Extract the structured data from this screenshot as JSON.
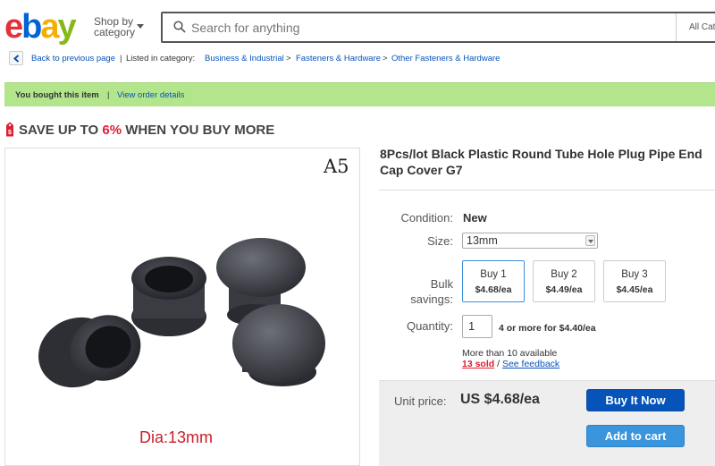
{
  "header": {
    "logo": {
      "e": "e",
      "b": "b",
      "a": "a",
      "y": "y"
    },
    "shop_by_line1": "Shop by",
    "shop_by_line2": "category",
    "search_placeholder": "Search for anything",
    "search_category": "All Cate"
  },
  "breadcrumb": {
    "back_label": "Back to previous page",
    "sep": "|",
    "listed_label": "Listed in category:",
    "items": [
      "Business & Industrial",
      "Fasteners & Hardware",
      "Other Fasteners & Hardware"
    ],
    "arrow": ">"
  },
  "bought_bar": {
    "text": "You bought this item",
    "sep": "|",
    "link": "View order details"
  },
  "save_banner": {
    "prefix": "SAVE UP TO ",
    "percent": "6%",
    "suffix": " WHEN YOU BUY MORE"
  },
  "image": {
    "corner_label": "A5",
    "caption": "Dia:13mm"
  },
  "item": {
    "title": "8Pcs/lot Black Plastic Round Tube Hole Plug Pipe End Cap Cover G7",
    "condition_label": "Condition:",
    "condition_value": "New",
    "size_label": "Size:",
    "size_value": "13mm",
    "bulk_label_1": "Bulk",
    "bulk_label_2": "savings:",
    "bulk_options": [
      {
        "qty": "Buy 1",
        "price": "$4.68/ea"
      },
      {
        "qty": "Buy 2",
        "price": "$4.49/ea"
      },
      {
        "qty": "Buy 3",
        "price": "$4.45/ea"
      }
    ],
    "quantity_label": "Quantity:",
    "quantity_value": "1",
    "quantity_note": "4 or more for $4.40/ea",
    "availability": "More than 10 available",
    "sold": "13 sold",
    "sold_sep": " / ",
    "feedback_link": "See feedback"
  },
  "buy_box": {
    "unit_price_label": "Unit price:",
    "unit_price_value": "US $4.68/ea",
    "buy_now": "Buy It Now",
    "add_to_cart": "Add to cart"
  },
  "colors": {
    "brand_blue": "#0654ba",
    "cart_blue": "#3a95dd",
    "alert_red": "#dd1e31",
    "success_green": "#b3e58c"
  }
}
